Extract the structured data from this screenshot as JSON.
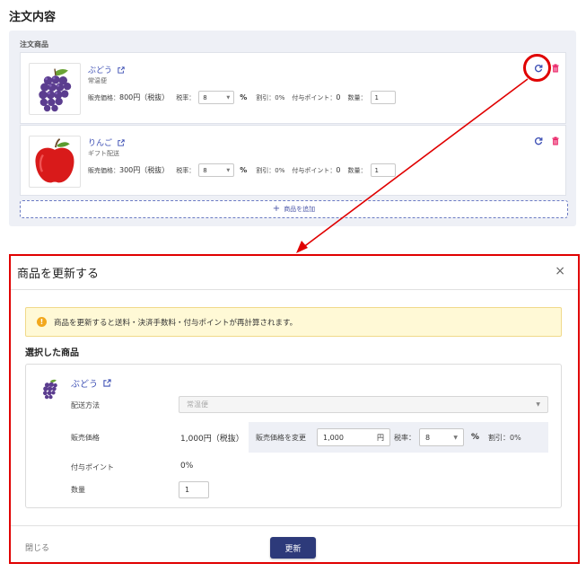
{
  "page": {
    "title": "注文内容"
  },
  "order_panel": {
    "label": "注文商品",
    "items": [
      {
        "name": "ぶどう",
        "delivery": "常温便",
        "price_label": "販売価格：",
        "price_value": "800円（税抜）",
        "tax_label": "税率：",
        "tax_value": "8",
        "pct": "%",
        "discount": "割引：0%",
        "points_label": "付与ポイント：",
        "points_value": "0",
        "qty_label": "数量：",
        "qty_value": "1"
      },
      {
        "name": "りんご",
        "delivery": "ギフト配送",
        "price_label": "販売価格：",
        "price_value": "300円（税抜）",
        "tax_label": "税率：",
        "tax_value": "8",
        "pct": "%",
        "discount": "割引：0%",
        "points_label": "付与ポイント：",
        "points_value": "0",
        "qty_label": "数量：",
        "qty_value": "1"
      }
    ],
    "add_label": "商品を追加"
  },
  "dialog": {
    "title": "商品を更新する",
    "close_icon": "×",
    "warning": "商品を更新すると送料・決済手数料・付与ポイントが再計算されます。",
    "warning_icon": "!",
    "selected_title": "選択した商品",
    "product": {
      "name": "ぶどう",
      "delivery_label": "配送方法",
      "delivery_value": "常温便",
      "price_label": "販売価格",
      "price_value": "1,000円（税抜）",
      "change_label": "販売価格を変更",
      "change_value": "1,000",
      "change_unit": "円",
      "tax_label": "税率：",
      "tax_value": "8",
      "pct": "%",
      "discount": "割引：0%",
      "points_label": "付与ポイント",
      "points_value": "0%",
      "qty_label": "数量",
      "qty_value": "1"
    },
    "footer": {
      "close_label": "閉じる",
      "update_label": "更新"
    }
  },
  "colors": {
    "accent": "#3f51b5",
    "primary_button": "#2d3a7a",
    "highlight": "#e00000",
    "delete": "#e91e63",
    "warning_bg": "#fff9d6"
  }
}
